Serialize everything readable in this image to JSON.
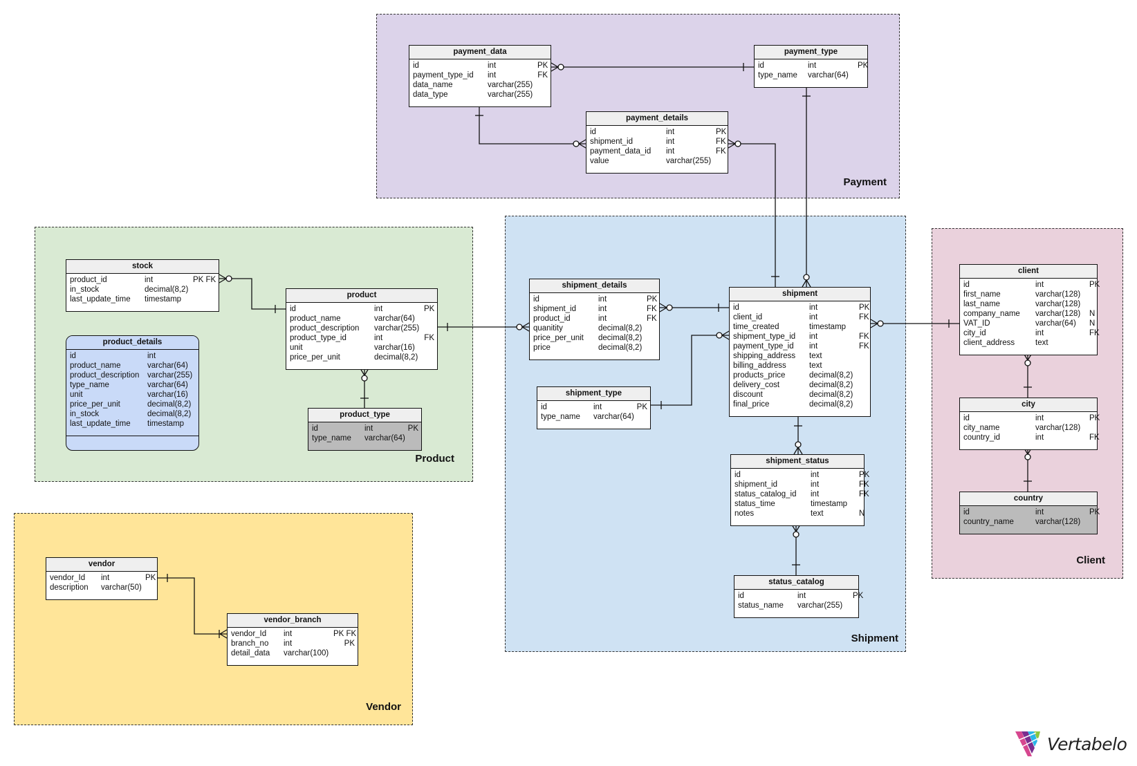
{
  "areas": {
    "payment": {
      "label": "Payment",
      "color": "#dcd3ea"
    },
    "product": {
      "label": "Product",
      "color": "#d9ead3"
    },
    "shipment": {
      "label": "Shipment",
      "color": "#cfe2f3"
    },
    "client": {
      "label": "Client",
      "color": "#ead1dc"
    },
    "vendor": {
      "label": "Vendor",
      "color": "#ffe599"
    }
  },
  "tables": {
    "payment_data": {
      "name": "payment_data",
      "columns": [
        [
          "id",
          "int",
          "PK"
        ],
        [
          "payment_type_id",
          "int",
          "FK"
        ],
        [
          "data_name",
          "varchar(255)",
          ""
        ],
        [
          "data_type",
          "varchar(255)",
          ""
        ]
      ]
    },
    "payment_type": {
      "name": "payment_type",
      "columns": [
        [
          "id",
          "int",
          "PK"
        ],
        [
          "type_name",
          "varchar(64)",
          ""
        ]
      ]
    },
    "payment_details": {
      "name": "payment_details",
      "columns": [
        [
          "id",
          "int",
          "PK"
        ],
        [
          "shipment_id",
          "int",
          "FK"
        ],
        [
          "payment_data_id",
          "int",
          "FK"
        ],
        [
          "value",
          "varchar(255)",
          ""
        ]
      ]
    },
    "stock": {
      "name": "stock",
      "columns": [
        [
          "product_id",
          "int",
          "PK FK"
        ],
        [
          "in_stock",
          "decimal(8,2)",
          ""
        ],
        [
          "last_update_time",
          "timestamp",
          ""
        ]
      ]
    },
    "product": {
      "name": "product",
      "columns": [
        [
          "id",
          "int",
          "PK"
        ],
        [
          "product_name",
          "varchar(64)",
          ""
        ],
        [
          "product_description",
          "varchar(255)",
          ""
        ],
        [
          "product_type_id",
          "int",
          "FK"
        ],
        [
          "unit",
          "varchar(16)",
          ""
        ],
        [
          "price_per_unit",
          "decimal(8,2)",
          ""
        ]
      ]
    },
    "product_details": {
      "name": "product_details",
      "columns": [
        [
          "id",
          "int",
          ""
        ],
        [
          "product_name",
          "varchar(64)",
          ""
        ],
        [
          "product_description",
          "varchar(255)",
          ""
        ],
        [
          "type_name",
          "varchar(64)",
          ""
        ],
        [
          "unit",
          "varchar(16)",
          ""
        ],
        [
          "price_per_unit",
          "decimal(8,2)",
          ""
        ],
        [
          "in_stock",
          "decimal(8,2)",
          ""
        ],
        [
          "last_update_time",
          "timestamp",
          ""
        ]
      ]
    },
    "product_type": {
      "name": "product_type",
      "columns": [
        [
          "id",
          "int",
          "PK"
        ],
        [
          "type_name",
          "varchar(64)",
          ""
        ]
      ]
    },
    "shipment_details": {
      "name": "shipment_details",
      "columns": [
        [
          "id",
          "int",
          "PK"
        ],
        [
          "shipment_id",
          "int",
          "FK"
        ],
        [
          "product_id",
          "int",
          "FK"
        ],
        [
          "quanitity",
          "decimal(8,2)",
          ""
        ],
        [
          "price_per_unit",
          "decimal(8,2)",
          ""
        ],
        [
          "price",
          "decimal(8,2)",
          ""
        ]
      ]
    },
    "shipment": {
      "name": "shipment",
      "columns": [
        [
          "id",
          "int",
          "PK"
        ],
        [
          "client_id",
          "int",
          "FK"
        ],
        [
          "time_created",
          "timestamp",
          ""
        ],
        [
          "shipment_type_id",
          "int",
          "FK"
        ],
        [
          "payment_type_id",
          "int",
          "FK"
        ],
        [
          "shipping_address",
          "text",
          ""
        ],
        [
          "billing_address",
          "text",
          ""
        ],
        [
          "products_price",
          "decimal(8,2)",
          ""
        ],
        [
          "delivery_cost",
          "decimal(8,2)",
          ""
        ],
        [
          "discount",
          "decimal(8,2)",
          ""
        ],
        [
          "final_price",
          "decimal(8,2)",
          ""
        ]
      ]
    },
    "shipment_type": {
      "name": "shipment_type",
      "columns": [
        [
          "id",
          "int",
          "PK"
        ],
        [
          "type_name",
          "varchar(64)",
          ""
        ]
      ]
    },
    "shipment_status": {
      "name": "shipment_status",
      "columns": [
        [
          "id",
          "int",
          "PK"
        ],
        [
          "shipment_id",
          "int",
          "FK"
        ],
        [
          "status_catalog_id",
          "int",
          "FK"
        ],
        [
          "status_time",
          "timestamp",
          ""
        ],
        [
          "notes",
          "text",
          "N"
        ]
      ]
    },
    "status_catalog": {
      "name": "status_catalog",
      "columns": [
        [
          "id",
          "int",
          "PK"
        ],
        [
          "status_name",
          "varchar(255)",
          ""
        ]
      ]
    },
    "client": {
      "name": "client",
      "columns": [
        [
          "id",
          "int",
          "PK"
        ],
        [
          "first_name",
          "varchar(128)",
          ""
        ],
        [
          "last_name",
          "varchar(128)",
          ""
        ],
        [
          "company_name",
          "varchar(128)",
          "N"
        ],
        [
          "VAT_ID",
          "varchar(64)",
          "N"
        ],
        [
          "city_id",
          "int",
          "FK"
        ],
        [
          "client_address",
          "text",
          ""
        ]
      ]
    },
    "city": {
      "name": "city",
      "columns": [
        [
          "id",
          "int",
          "PK"
        ],
        [
          "city_name",
          "varchar(128)",
          ""
        ],
        [
          "country_id",
          "int",
          "FK"
        ]
      ]
    },
    "country": {
      "name": "country",
      "columns": [
        [
          "id",
          "int",
          "PK"
        ],
        [
          "country_name",
          "varchar(128)",
          ""
        ]
      ]
    },
    "vendor": {
      "name": "vendor",
      "columns": [
        [
          "vendor_Id",
          "int",
          "PK"
        ],
        [
          "description",
          "varchar(50)",
          ""
        ]
      ]
    },
    "vendor_branch": {
      "name": "vendor_branch",
      "columns": [
        [
          "vendor_Id",
          "int",
          "PK FK"
        ],
        [
          "branch_no",
          "int",
          "PK"
        ],
        [
          "detail_data",
          "varchar(100)",
          ""
        ]
      ]
    }
  },
  "relationships": [
    {
      "from": "payment_data",
      "to": "payment_type",
      "from_card": "zero-or-many",
      "to_card": "one"
    },
    {
      "from": "payment_details",
      "to": "payment_data",
      "from_card": "zero-or-many",
      "to_card": "one"
    },
    {
      "from": "payment_details",
      "to": "shipment",
      "from_card": "zero-or-many",
      "to_card": "one"
    },
    {
      "from": "shipment",
      "to": "payment_type",
      "from_card": "zero-or-many",
      "to_card": "one"
    },
    {
      "from": "stock",
      "to": "product",
      "from_card": "zero-or-many",
      "to_card": "one"
    },
    {
      "from": "product",
      "to": "product_type",
      "from_card": "zero-or-many",
      "to_card": "one"
    },
    {
      "from": "shipment_details",
      "to": "product",
      "from_card": "zero-or-many",
      "to_card": "one"
    },
    {
      "from": "shipment_details",
      "to": "shipment",
      "from_card": "zero-or-many",
      "to_card": "one"
    },
    {
      "from": "shipment",
      "to": "shipment_type",
      "from_card": "zero-or-many",
      "to_card": "one"
    },
    {
      "from": "shipment",
      "to": "client",
      "from_card": "zero-or-many",
      "to_card": "one"
    },
    {
      "from": "shipment_status",
      "to": "shipment",
      "from_card": "zero-or-many",
      "to_card": "one"
    },
    {
      "from": "shipment_status",
      "to": "status_catalog",
      "from_card": "zero-or-many",
      "to_card": "one"
    },
    {
      "from": "client",
      "to": "city",
      "from_card": "zero-or-many",
      "to_card": "one"
    },
    {
      "from": "city",
      "to": "country",
      "from_card": "zero-or-many",
      "to_card": "one"
    },
    {
      "from": "vendor_branch",
      "to": "vendor",
      "from_card": "one-or-many",
      "to_card": "one"
    }
  ],
  "logo": {
    "text": "Vertabelo",
    "icon": "vertabelo-logo-icon"
  }
}
